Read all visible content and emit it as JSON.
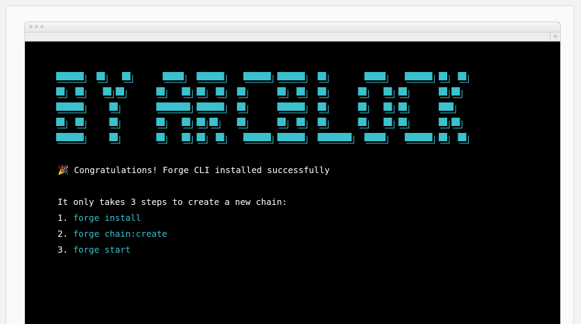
{
  "colors": {
    "accent": "#3bc1cd",
    "background": "#000000",
    "text": "#ffffff"
  },
  "window": {
    "traffic_lights": [
      "close-dot",
      "minimize-dot",
      "maximize-dot"
    ],
    "new_tab_icon": "plus-icon",
    "new_tab_glyph": "+"
  },
  "terminal": {
    "banner": {
      "text": "BY ARCBLOCK",
      "style": "ascii-art-block-letters"
    },
    "success_emoji": "🎉",
    "success_message": "Congratulations! Forge CLI installed successfully",
    "intro": "It only takes 3 steps to create a new chain:",
    "steps": [
      {
        "number": "1.",
        "command": "forge install"
      },
      {
        "number": "2.",
        "command": "forge chain:create"
      },
      {
        "number": "3.",
        "command": "forge start"
      }
    ]
  }
}
